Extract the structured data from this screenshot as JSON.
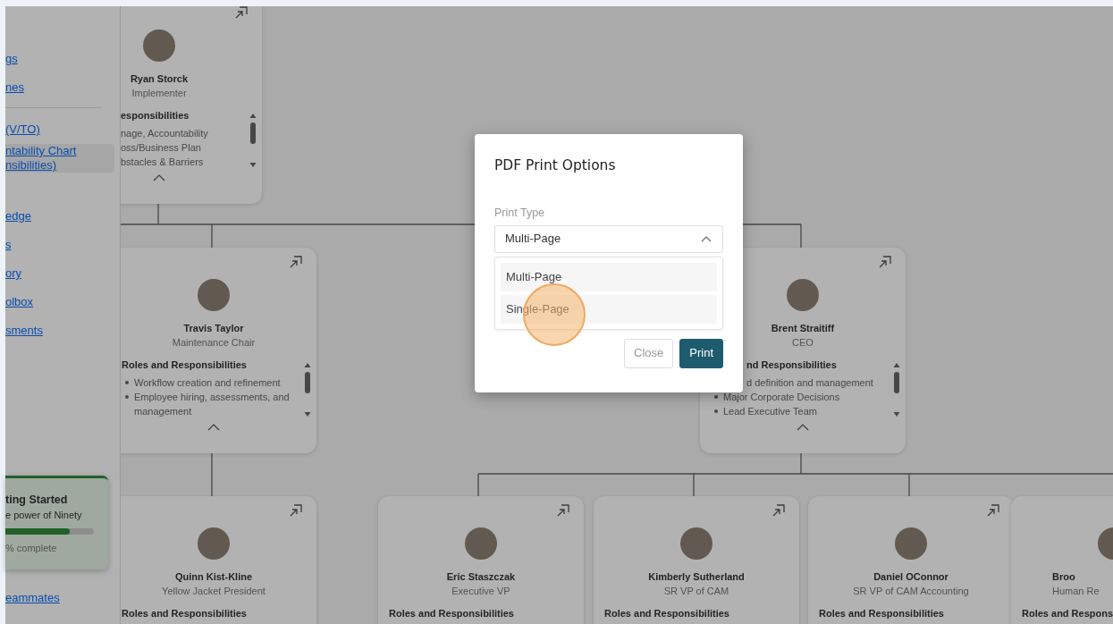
{
  "sidebar": {
    "items": [
      {
        "lines": [
          "gs"
        ],
        "selected": false
      },
      {
        "lines": [
          "nes"
        ],
        "selected": false
      },
      {
        "lines": [
          "(V/TO)"
        ],
        "selected": false
      },
      {
        "lines": [
          "ntability Chart",
          "nsibilities)"
        ],
        "selected": true
      },
      {
        "lines": [
          "edge"
        ],
        "selected": false
      },
      {
        "lines": [
          "s"
        ],
        "selected": false
      },
      {
        "lines": [
          "ory"
        ],
        "selected": false
      },
      {
        "lines": [
          "olbox"
        ],
        "selected": false
      },
      {
        "lines": [
          "sments"
        ],
        "selected": false
      }
    ],
    "getting_started": {
      "title": "ting Started",
      "subtitle": "e power of Ninety",
      "level": 0.73,
      "progress_text": "% complete"
    },
    "footer_items": [
      {
        "label": "eammates"
      }
    ]
  },
  "org_chart": {
    "cards": [
      {
        "name": "Ryan Storck",
        "title": "Implementer",
        "heading": "esponsibilities",
        "responsibilities": [
          "nage, Accountability",
          "oss/Business Plan",
          "bstacles & Barriers"
        ],
        "expanded": true
      },
      {
        "name": "Travis Taylor",
        "title": "Maintenance Chair",
        "heading": "Roles and Responsibilities",
        "responsibilities": [
          "Workflow creation and refinement",
          "Employee hiring, assessments, and management"
        ],
        "expanded": true
      },
      {
        "name": "Brent Straitiff",
        "title": "CEO",
        "heading": "nd Responsibilities",
        "responsibilities": [
          "d definition and management",
          "Major Corporate Decisions",
          "Lead Executive Team"
        ],
        "expanded": true
      },
      {
        "name": "Quinn Kist-Kline",
        "title": "Yellow Jacket President",
        "heading": "Roles and Responsibilities"
      },
      {
        "name": "Eric Staszczak",
        "title": "Executive VP",
        "heading": "Roles and Responsibilities"
      },
      {
        "name": "Kimberly Sutherland",
        "title": "SR VP of CAM",
        "heading": "Roles and Responsibilities"
      },
      {
        "name": "Daniel OConnor",
        "title": "SR VP of CAM Accounting",
        "heading": "Roles and Responsibilities"
      },
      {
        "name": "Broo",
        "title": "Human Re",
        "heading": "Roles and Respons"
      }
    ]
  },
  "dialog": {
    "title": "PDF Print Options",
    "select": {
      "label": "Print Type",
      "value": "Multi-Page",
      "expanded": true
    },
    "options": [
      {
        "label": "Multi-Page",
        "selected": false
      },
      {
        "label": "Single-Page",
        "selected": false
      }
    ],
    "buttons": [
      {
        "label": "Close",
        "kind": "secondary"
      },
      {
        "label": "Print",
        "kind": "primary"
      }
    ]
  }
}
